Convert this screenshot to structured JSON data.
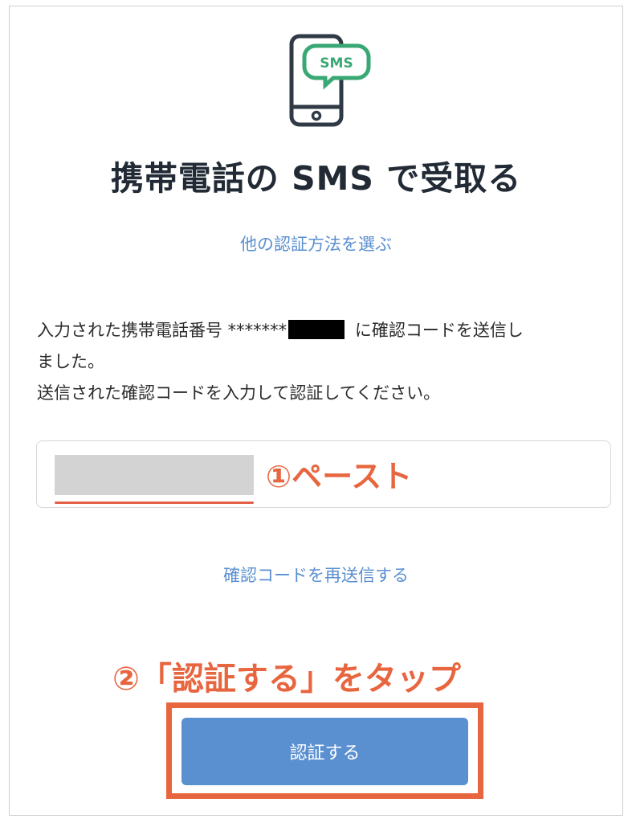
{
  "header": {
    "icon_label": "SMS",
    "title": "携帯電話の SMS で受取る"
  },
  "links": {
    "other_method": "他の認証方法を選ぶ",
    "resend": "確認コードを再送信する"
  },
  "message": {
    "line1_prefix": "入力された携帯電話番号 *******",
    "line1_suffix": " に確認コードを送信し",
    "line2": "ました。",
    "line3": "送信された確認コードを入力して認証してください。"
  },
  "annotations": {
    "paste": "①ペースト",
    "tap": "②「認証する」をタップ"
  },
  "buttons": {
    "verify": "認証する"
  },
  "colors": {
    "link": "#5a8fd0",
    "button": "#5a8fd0",
    "annotation": "#e8663f",
    "icon_green": "#3aa874"
  }
}
